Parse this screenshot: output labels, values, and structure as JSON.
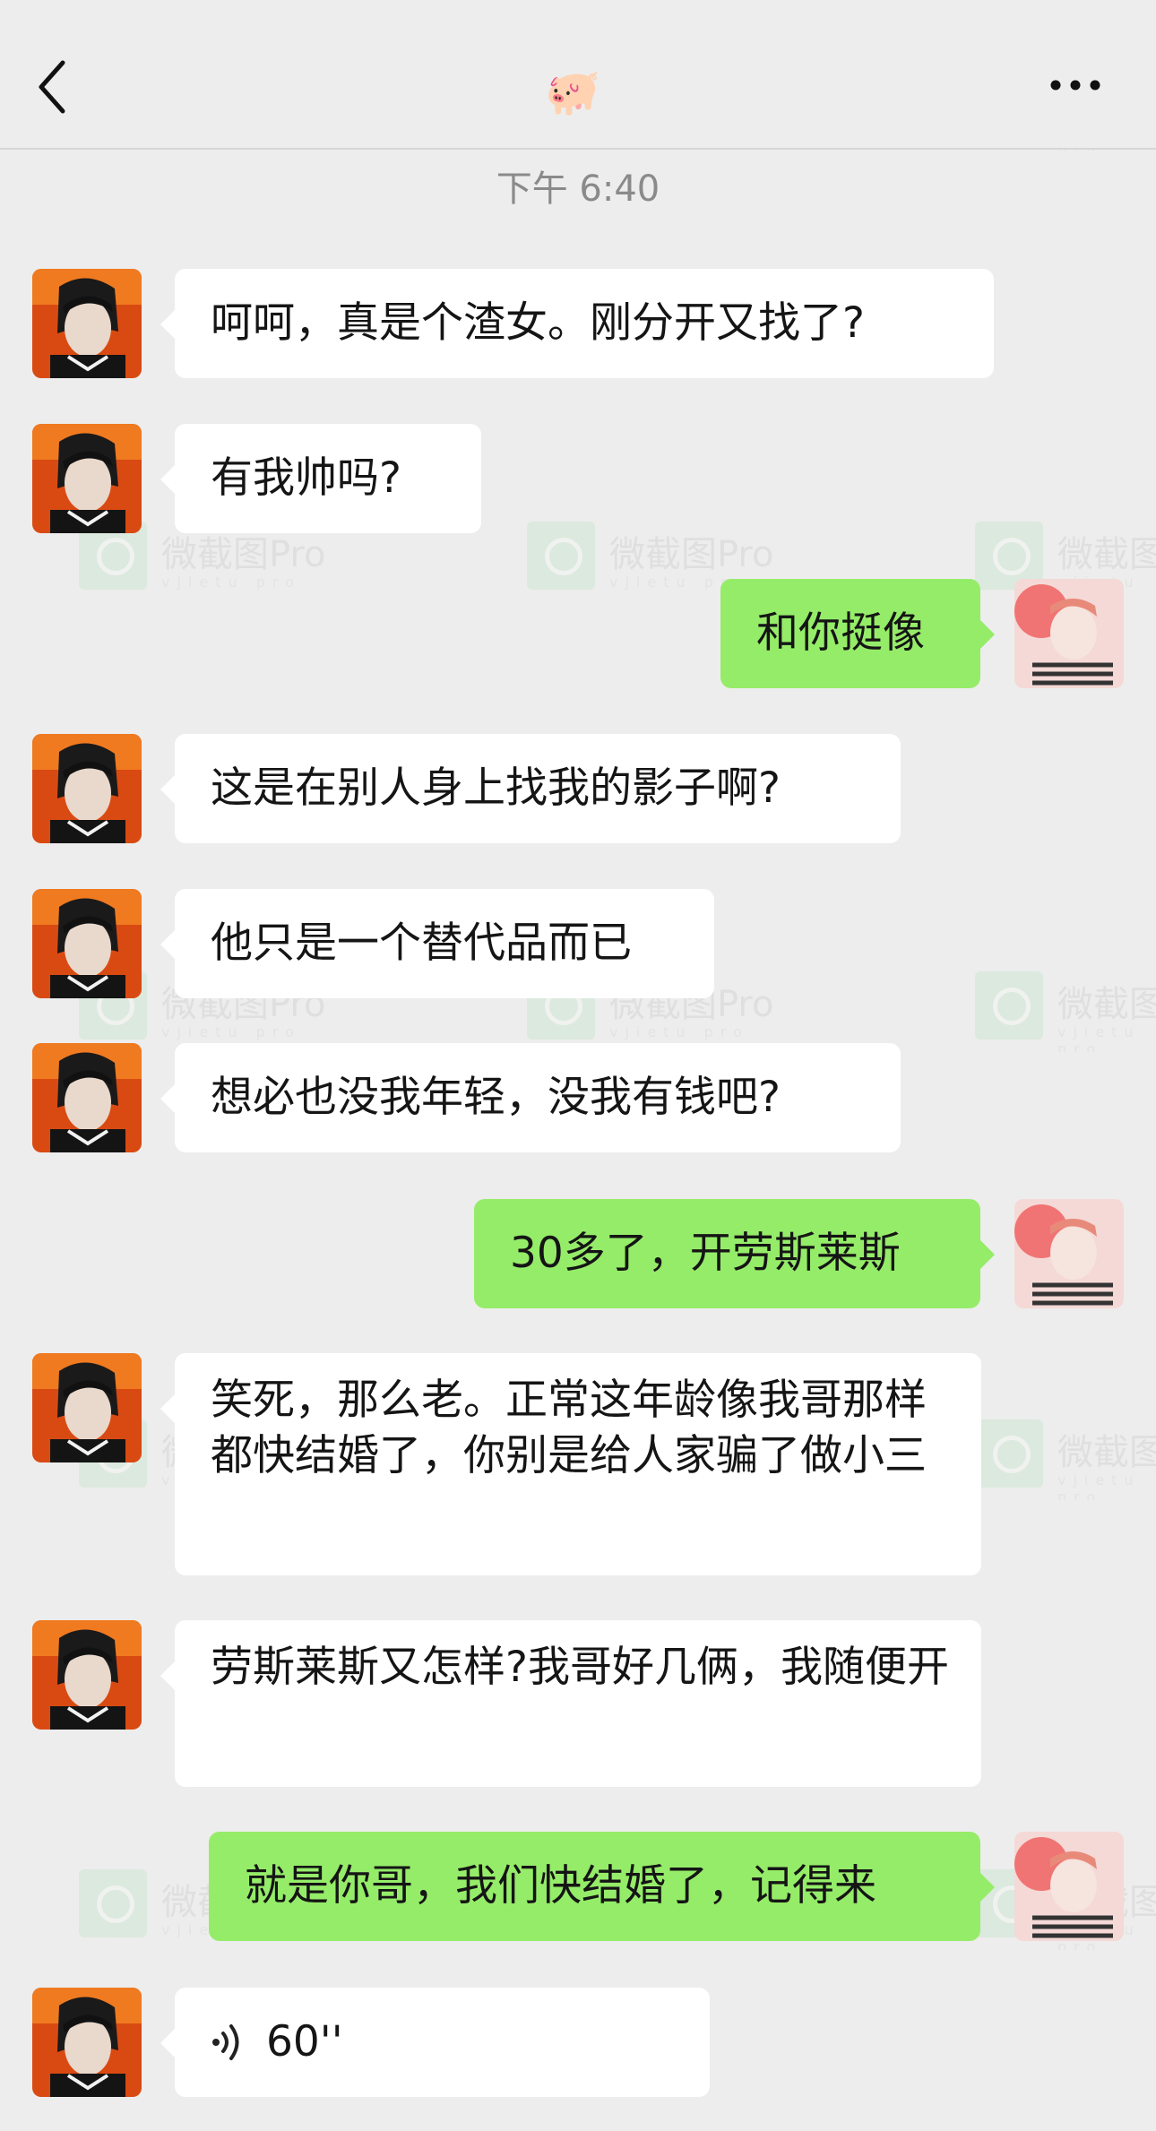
{
  "header": {
    "title_icon": "🐖",
    "back_icon": "chevron-left-icon",
    "more_icon": "ellipsis-icon"
  },
  "timestamp": "下午 6:40",
  "watermark": {
    "text": "微截图Pro",
    "sub": "vjietu pro"
  },
  "messages": [
    {
      "side": "in",
      "text": "呵呵，真是个渣女。刚分开又找了?"
    },
    {
      "side": "in",
      "text": "有我帅吗?"
    },
    {
      "side": "out",
      "text": "和你挺像"
    },
    {
      "side": "in",
      "text": "这是在别人身上找我的影子啊?"
    },
    {
      "side": "in",
      "text": "他只是一个替代品而已"
    },
    {
      "side": "in",
      "text": "想必也没我年轻，没我有钱吧?"
    },
    {
      "side": "out",
      "text": "30多了，开劳斯莱斯"
    },
    {
      "side": "in",
      "text": "笑死，那么老。正常这年龄像我哥那样都快结婚了，你别是给人家骗了做小三"
    },
    {
      "side": "in",
      "text": "劳斯莱斯又怎样?我哥好几俩，我随便开"
    },
    {
      "side": "out",
      "text": "就是你哥，我们快结婚了，记得来"
    },
    {
      "side": "in",
      "type": "voice",
      "text": "60''",
      "icon": "voice-wave-icon"
    }
  ],
  "colors": {
    "background": "#ededed",
    "incoming_bubble": "#ffffff",
    "outgoing_bubble": "#95ec69",
    "timestamp_text": "#8a8a8a"
  }
}
